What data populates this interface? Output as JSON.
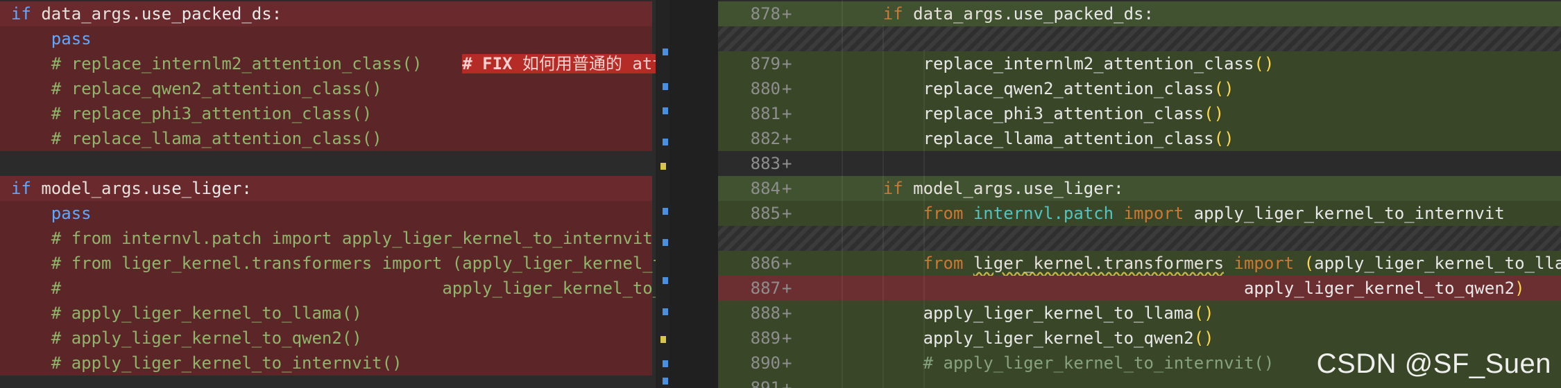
{
  "left": {
    "lines": [
      {
        "kind": "del-head",
        "parts": [
          {
            "c": "kw2",
            "t": "if "
          },
          {
            "c": "id",
            "t": "data_args"
          },
          {
            "c": "fn",
            "t": ".use_packed_ds:"
          }
        ]
      },
      {
        "kind": "del",
        "indent": "    ",
        "parts": [
          {
            "c": "kw2",
            "t": "pass"
          }
        ]
      },
      {
        "kind": "del",
        "indent": "    ",
        "parts": [
          {
            "c": "cm",
            "t": "# replace_internlm2_attention_class()"
          }
        ],
        "fix": "# FIX",
        "fix_text": "如何用普通的 atte"
      },
      {
        "kind": "del",
        "indent": "    ",
        "parts": [
          {
            "c": "cm",
            "t": "# replace_qwen2_attention_class()"
          }
        ]
      },
      {
        "kind": "del",
        "indent": "    ",
        "parts": [
          {
            "c": "cm",
            "t": "# replace_phi3_attention_class()"
          }
        ]
      },
      {
        "kind": "del",
        "indent": "    ",
        "parts": [
          {
            "c": "cm",
            "t": "# replace_llama_attention_class()"
          }
        ]
      },
      {
        "kind": "empty",
        "parts": []
      },
      {
        "kind": "del-head",
        "parts": [
          {
            "c": "kw2",
            "t": "if "
          },
          {
            "c": "id",
            "t": "model_args"
          },
          {
            "c": "fn",
            "t": ".use_liger:"
          }
        ]
      },
      {
        "kind": "del",
        "indent": "    ",
        "parts": [
          {
            "c": "kw2",
            "t": "pass"
          }
        ]
      },
      {
        "kind": "del",
        "indent": "    ",
        "parts": [
          {
            "c": "cm",
            "t": "# from internvl.patch import apply_liger_kernel_to_internvit"
          }
        ]
      },
      {
        "kind": "del",
        "indent": "    ",
        "parts": [
          {
            "c": "cm",
            "t": "# from liger_kernel.transformers import (apply_liger_kernel_to"
          }
        ]
      },
      {
        "kind": "del",
        "indent": "    ",
        "parts": [
          {
            "c": "cm",
            "t": "#                                      apply_liger_kernel_to_qw"
          }
        ]
      },
      {
        "kind": "del",
        "indent": "    ",
        "parts": [
          {
            "c": "cm",
            "t": "# apply_liger_kernel_to_llama()"
          }
        ]
      },
      {
        "kind": "del",
        "indent": "    ",
        "parts": [
          {
            "c": "cm",
            "t": "# apply_liger_kernel_to_qwen2()"
          }
        ]
      },
      {
        "kind": "del",
        "indent": "    ",
        "parts": [
          {
            "c": "cm",
            "t": "# apply_liger_kernel_to_internvit()"
          }
        ]
      }
    ]
  },
  "right": {
    "lines": [
      {
        "num": "878",
        "kind": "add-head",
        "indent": "    ",
        "parts": [
          {
            "c": "kw",
            "t": "if "
          },
          {
            "c": "id",
            "t": "data_args"
          },
          {
            "c": "fn",
            "t": ".use_packed_ds:"
          }
        ]
      },
      {
        "num": "",
        "kind": "hatch",
        "parts": []
      },
      {
        "num": "879",
        "kind": "add",
        "indent": "        ",
        "parts": [
          {
            "c": "fn",
            "t": "replace_internlm2_attention_class"
          },
          {
            "c": "par",
            "t": "()"
          }
        ]
      },
      {
        "num": "880",
        "kind": "add",
        "indent": "        ",
        "parts": [
          {
            "c": "fn",
            "t": "replace_qwen2_attention_class"
          },
          {
            "c": "par",
            "t": "()"
          }
        ]
      },
      {
        "num": "881",
        "kind": "add",
        "indent": "        ",
        "parts": [
          {
            "c": "fn",
            "t": "replace_phi3_attention_class"
          },
          {
            "c": "par",
            "t": "()"
          }
        ]
      },
      {
        "num": "882",
        "kind": "add",
        "indent": "        ",
        "parts": [
          {
            "c": "fn",
            "t": "replace_llama_attention_class"
          },
          {
            "c": "par",
            "t": "()"
          }
        ]
      },
      {
        "num": "883",
        "kind": "empty",
        "parts": []
      },
      {
        "num": "884",
        "kind": "add-head",
        "indent": "    ",
        "parts": [
          {
            "c": "kw",
            "t": "if "
          },
          {
            "c": "id",
            "t": "model_args"
          },
          {
            "c": "fn",
            "t": ".use_liger:"
          }
        ]
      },
      {
        "num": "885",
        "kind": "add",
        "indent": "        ",
        "parts": [
          {
            "c": "kw",
            "t": "from "
          },
          {
            "c": "mod",
            "t": "internvl.patch"
          },
          {
            "c": "kw",
            "t": " import "
          },
          {
            "c": "fn",
            "t": "apply_liger_kernel_to_internvit"
          }
        ]
      },
      {
        "num": "",
        "kind": "hatch",
        "parts": []
      },
      {
        "num": "886",
        "kind": "add",
        "indent": "        ",
        "parts": [
          {
            "c": "kw",
            "t": "from "
          },
          {
            "c": "wavy id",
            "t": "liger_kernel.transformers"
          },
          {
            "c": "kw",
            "t": " import "
          },
          {
            "c": "par",
            "t": "("
          },
          {
            "c": "fn",
            "t": "apply_liger_kernel_to_llama,"
          }
        ]
      },
      {
        "num": "887",
        "kind": "mod-red",
        "indent": "                                        ",
        "parts": [
          {
            "c": "fn",
            "t": "apply_liger_kernel_to_qwen2"
          },
          {
            "c": "par",
            "t": ")"
          }
        ]
      },
      {
        "num": "888",
        "kind": "add",
        "indent": "        ",
        "parts": [
          {
            "c": "fn",
            "t": "apply_liger_kernel_to_llama"
          },
          {
            "c": "par",
            "t": "()"
          }
        ]
      },
      {
        "num": "889",
        "kind": "add",
        "indent": "        ",
        "parts": [
          {
            "c": "fn",
            "t": "apply_liger_kernel_to_qwen2"
          },
          {
            "c": "par",
            "t": "()"
          }
        ]
      },
      {
        "num": "890",
        "kind": "add",
        "indent": "        ",
        "parts": [
          {
            "c": "cm-dim",
            "t": "# apply_liger_kernel_to_internvit()"
          }
        ]
      },
      {
        "num": "891",
        "kind": "add",
        "parts": []
      }
    ],
    "plus_sign": "+"
  },
  "watermark": "CSDN @SF_Suen",
  "colors": {
    "deleted": "#5c2629",
    "added": "#394628",
    "fix_tag": "#b52b25"
  }
}
